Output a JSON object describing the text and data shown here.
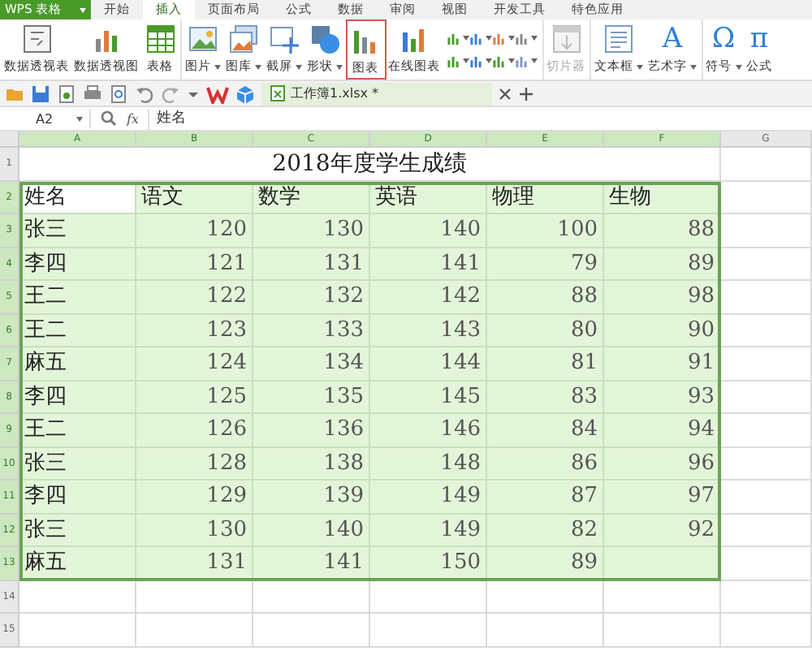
{
  "app": {
    "logo": "WPS 表格"
  },
  "menu_tabs": [
    {
      "label": "开始",
      "selected": false
    },
    {
      "label": "插入",
      "selected": true
    },
    {
      "label": "页面布局",
      "selected": false
    },
    {
      "label": "公式",
      "selected": false
    },
    {
      "label": "数据",
      "selected": false
    },
    {
      "label": "审阅",
      "selected": false
    },
    {
      "label": "视图",
      "selected": false
    },
    {
      "label": "开发工具",
      "selected": false
    },
    {
      "label": "特色应用",
      "selected": false
    }
  ],
  "ribbon": [
    {
      "kind": "pivot",
      "label": "数据透视表",
      "dropdown": false,
      "selected": false,
      "disabled": false,
      "separator_before": false
    },
    {
      "kind": "pivotchart",
      "label": "数据透视图",
      "dropdown": false,
      "selected": false,
      "disabled": false,
      "separator_before": false
    },
    {
      "kind": "table",
      "label": "表格",
      "dropdown": false,
      "selected": false,
      "disabled": false,
      "separator_before": false
    },
    {
      "kind": "picture",
      "label": "图片",
      "dropdown": true,
      "selected": false,
      "disabled": false,
      "separator_before": true
    },
    {
      "kind": "gallery",
      "label": "图库",
      "dropdown": true,
      "selected": false,
      "disabled": false,
      "separator_before": false
    },
    {
      "kind": "screenshot",
      "label": "截屏",
      "dropdown": true,
      "selected": false,
      "disabled": false,
      "separator_before": false
    },
    {
      "kind": "shape",
      "label": "形状",
      "dropdown": true,
      "selected": false,
      "disabled": false,
      "separator_before": false
    },
    {
      "kind": "chart",
      "label": "图表",
      "dropdown": false,
      "selected": true,
      "disabled": false,
      "separator_before": false
    },
    {
      "kind": "online",
      "label": "在线图表",
      "dropdown": false,
      "selected": false,
      "disabled": false,
      "separator_before": false
    },
    {
      "kind": "chartgrid"
    },
    {
      "kind": "slicer",
      "label": "切片器",
      "dropdown": false,
      "selected": false,
      "disabled": true,
      "separator_before": true
    },
    {
      "kind": "textbox",
      "label": "文本框",
      "dropdown": true,
      "selected": false,
      "disabled": false,
      "separator_before": true
    },
    {
      "kind": "glyph",
      "glyph": "A",
      "label": "艺术字",
      "dropdown": true,
      "selected": false,
      "disabled": false,
      "separator_before": false
    },
    {
      "kind": "glyph",
      "glyph": "Ω",
      "label": "符号",
      "dropdown": true,
      "selected": false,
      "disabled": false,
      "separator_before": true
    },
    {
      "kind": "glyph",
      "glyph": "π",
      "label": "公式",
      "dropdown": false,
      "selected": false,
      "disabled": false,
      "separator_before": false
    }
  ],
  "document_tabs": [
    {
      "label": "工作簿1.xlsx *",
      "selected": true
    }
  ],
  "formula_bar": {
    "name_box": "A2",
    "fx": "fx",
    "value": "姓名"
  },
  "sheet": {
    "title": "2018年度学生成绩",
    "columns": [
      {
        "label": "A",
        "selected": true
      },
      {
        "label": "B",
        "selected": true
      },
      {
        "label": "C",
        "selected": true
      },
      {
        "label": "D",
        "selected": true
      },
      {
        "label": "E",
        "selected": true
      },
      {
        "label": "F",
        "selected": true
      },
      {
        "label": "G",
        "selected": false
      }
    ],
    "rows": [
      {
        "label": "1",
        "selected": false,
        "kind": "title"
      },
      {
        "label": "2",
        "selected": true,
        "kind": "header",
        "cells": [
          {
            "text": "姓名",
            "active": true
          },
          {
            "text": "语文",
            "active": false
          },
          {
            "text": "数学",
            "active": false
          },
          {
            "text": "英语",
            "active": false
          },
          {
            "text": "物理",
            "active": false
          },
          {
            "text": "生物",
            "active": false
          }
        ]
      },
      {
        "label": "3",
        "selected": true,
        "kind": "data",
        "cells": [
          "张三",
          "120",
          "130",
          "140",
          "100",
          "88"
        ]
      },
      {
        "label": "4",
        "selected": true,
        "kind": "data",
        "cells": [
          "李四",
          "121",
          "131",
          "141",
          "79",
          "89"
        ]
      },
      {
        "label": "5",
        "selected": true,
        "kind": "data",
        "cells": [
          "王二",
          "122",
          "132",
          "142",
          "88",
          "98"
        ]
      },
      {
        "label": "6",
        "selected": true,
        "kind": "data",
        "cells": [
          "王二",
          "123",
          "133",
          "143",
          "80",
          "90"
        ]
      },
      {
        "label": "7",
        "selected": true,
        "kind": "data",
        "cells": [
          "麻五",
          "124",
          "134",
          "144",
          "81",
          "91"
        ]
      },
      {
        "label": "8",
        "selected": true,
        "kind": "data",
        "cells": [
          "李四",
          "125",
          "135",
          "145",
          "83",
          "93"
        ]
      },
      {
        "label": "9",
        "selected": true,
        "kind": "data",
        "cells": [
          "王二",
          "126",
          "136",
          "146",
          "84",
          "94"
        ]
      },
      {
        "label": "10",
        "selected": true,
        "kind": "data",
        "cells": [
          "张三",
          "128",
          "138",
          "148",
          "86",
          "96"
        ]
      },
      {
        "label": "11",
        "selected": true,
        "kind": "data",
        "cells": [
          "李四",
          "129",
          "139",
          "149",
          "87",
          "97"
        ]
      },
      {
        "label": "12",
        "selected": true,
        "kind": "data",
        "cells": [
          "张三",
          "130",
          "140",
          "149",
          "82",
          "92"
        ]
      },
      {
        "label": "13",
        "selected": true,
        "kind": "data",
        "cells": [
          "麻五",
          "131",
          "141",
          "150",
          "89"
        ]
      },
      {
        "label": "14",
        "selected": false,
        "kind": "data"
      },
      {
        "label": "15",
        "selected": false,
        "kind": "data"
      }
    ]
  }
}
